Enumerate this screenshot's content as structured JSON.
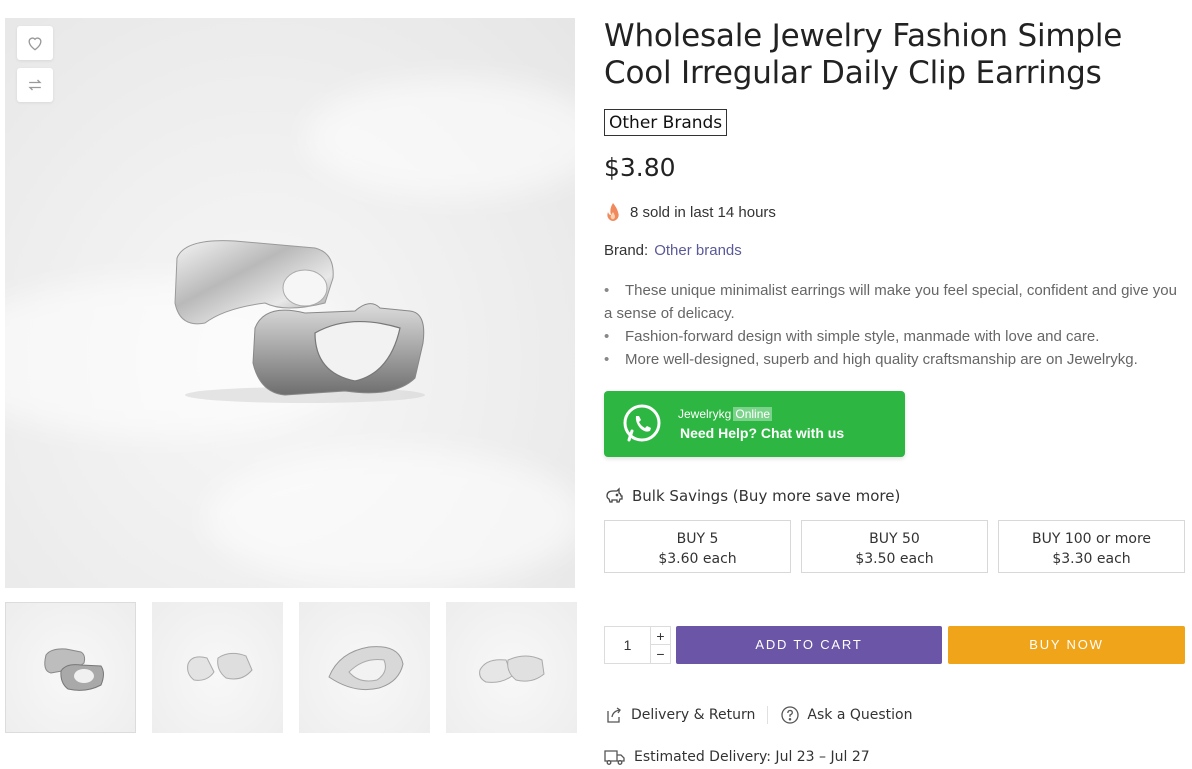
{
  "product": {
    "title": "Wholesale Jewelry Fashion Simple Cool Irregular Daily Clip Earrings",
    "brand_tag": "Other Brands",
    "price": "$3.80",
    "sold_text": "8 sold in last 14 hours",
    "brand_label": "Brand:",
    "brand_link": "Other brands",
    "features": [
      "These unique minimalist earrings will make you feel special, confident and give you a sense of delicacy.",
      "Fashion-forward design with simple style, manmade with love and care.",
      "More well-designed, superb and high quality craftsmanship are on Jewelrykg."
    ]
  },
  "gallery": {
    "icons": [
      "heart-icon",
      "compare-icon"
    ],
    "thumbnail_count": 4
  },
  "whatsapp": {
    "name": "Jewelrykg",
    "status": "Online",
    "cta": "Need Help? Chat with us",
    "color": "#2db742"
  },
  "bulk": {
    "title": "Bulk Savings (Buy more save more)",
    "tiers": [
      {
        "qty": "BUY 5",
        "price": "$3.60 each"
      },
      {
        "qty": "BUY 50",
        "price": "$3.50 each"
      },
      {
        "qty": "BUY 100 or more",
        "price": "$3.30 each"
      }
    ]
  },
  "cart": {
    "quantity": "1",
    "plus": "+",
    "minus": "−",
    "add_to_cart": "ADD TO CART",
    "buy_now": "BUY NOW",
    "add_color": "#6a55a6",
    "buy_color": "#f0a419"
  },
  "links": {
    "delivery_return": "Delivery & Return",
    "ask_question": "Ask a Question"
  },
  "delivery": {
    "text": "Estimated Delivery: Jul 23 – Jul 27"
  }
}
